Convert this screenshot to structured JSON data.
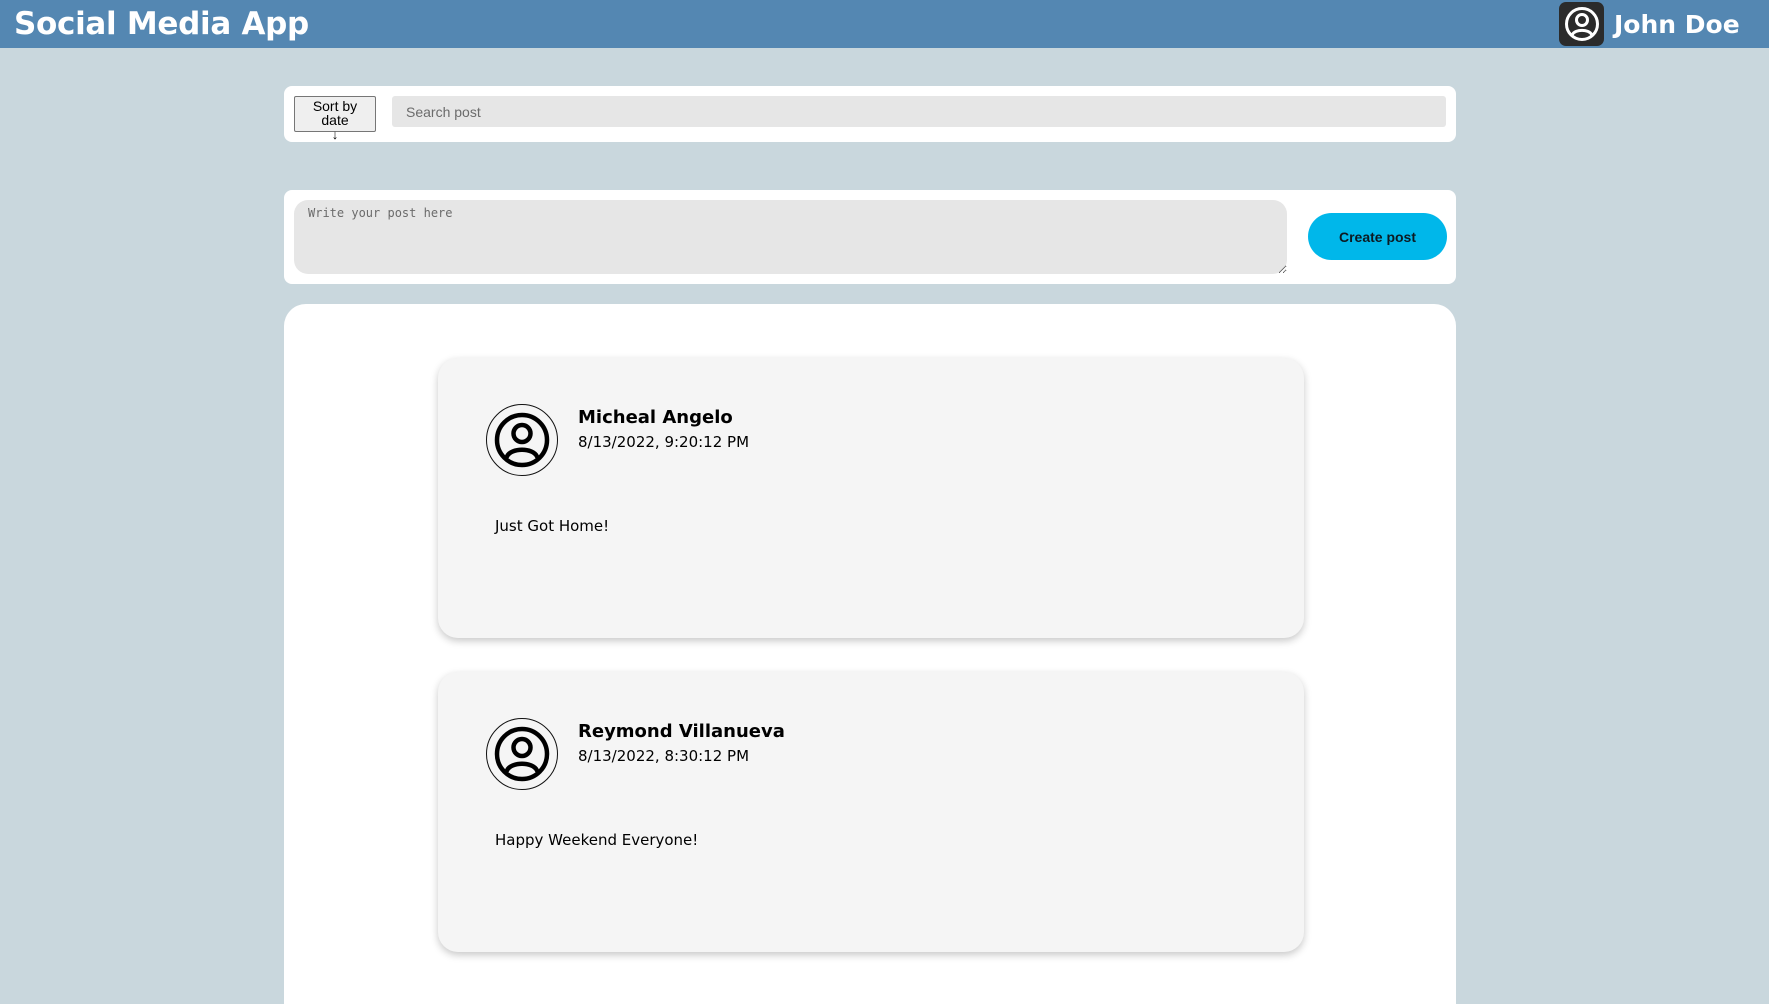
{
  "header": {
    "app_title": "Social Media App",
    "user": {
      "name": "John Doe",
      "avatar_icon": "user-circle-icon"
    },
    "background_color": "#5487b2"
  },
  "search_bar": {
    "sort_label": "Sort by date",
    "sort_arrow": "↓",
    "sort_icon": "arrow-down-icon",
    "search_value": "",
    "search_placeholder": "Search post"
  },
  "composer": {
    "post_value": "",
    "post_placeholder": "Write your post here",
    "create_label": "Create post",
    "create_color": "#00b7ea"
  },
  "feed": {
    "posts": [
      {
        "author": "Micheal Angelo",
        "date": "8/13/2022, 9:20:12 PM",
        "content": "Just Got Home!",
        "avatar_icon": "user-circle-icon"
      },
      {
        "author": "Reymond Villanueva",
        "date": "8/13/2022, 8:30:12 PM",
        "content": "Happy Weekend Everyone!",
        "avatar_icon": "user-circle-icon"
      }
    ]
  },
  "page_background": "#c9d7dd"
}
